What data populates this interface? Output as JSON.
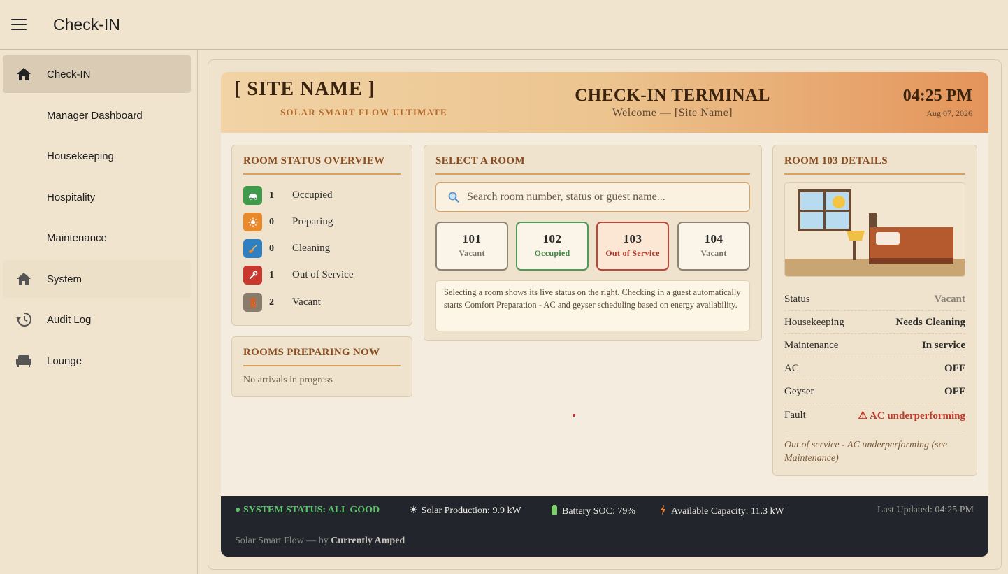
{
  "app": {
    "title": "Check-IN"
  },
  "sidebar": {
    "items": [
      {
        "label": "Check-IN",
        "icon": "home-icon"
      },
      {
        "label": "Manager Dashboard"
      },
      {
        "label": "Housekeeping"
      },
      {
        "label": "Hospitality"
      },
      {
        "label": "Maintenance"
      },
      {
        "label": "System",
        "icon": "home-icon"
      },
      {
        "label": "Audit Log",
        "icon": "history-icon"
      },
      {
        "label": "Lounge",
        "icon": "sofa-icon"
      }
    ]
  },
  "header": {
    "site_name": "[ SITE NAME ]",
    "subtitle": "SOLAR SMART FLOW ULTIMATE",
    "terminal_title": "CHECK-IN TERMINAL",
    "welcome": "Welcome — [Site Name]",
    "time": "04:25 PM",
    "date": "Aug 07, 2026"
  },
  "overview": {
    "title": "ROOM STATUS OVERVIEW",
    "rows": [
      {
        "count": "1",
        "label": "Occupied",
        "icon": "car-icon",
        "color": "#3f9a4c"
      },
      {
        "count": "0",
        "label": "Preparing",
        "icon": "sun-icon",
        "color": "#e8892c"
      },
      {
        "count": "0",
        "label": "Cleaning",
        "icon": "broom-icon",
        "color": "#2f7fc1"
      },
      {
        "count": "1",
        "label": "Out of Service",
        "icon": "wrench-icon",
        "color": "#c9382e"
      },
      {
        "count": "2",
        "label": "Vacant",
        "icon": "door-icon",
        "color": "#8a7c6c"
      }
    ]
  },
  "preparing": {
    "title": "ROOMS PREPARING NOW",
    "empty_text": "No arrivals in progress"
  },
  "select_room": {
    "title": "SELECT A ROOM",
    "search_placeholder": "Search room number, status or guest name...",
    "rooms": [
      {
        "number": "101",
        "status": "Vacant"
      },
      {
        "number": "102",
        "status": "Occupied"
      },
      {
        "number": "103",
        "status": "Out of Service"
      },
      {
        "number": "104",
        "status": "Vacant"
      }
    ],
    "note": "Selecting a room shows its live status on the right. Checking in a guest automatically starts Comfort Preparation - AC and geyser scheduling based on energy availability."
  },
  "details": {
    "title": "ROOM 103 DETAILS",
    "rows": [
      {
        "key": "Status",
        "value": "Vacant"
      },
      {
        "key": "Housekeeping",
        "value": "Needs Cleaning"
      },
      {
        "key": "Maintenance",
        "value": "In service"
      },
      {
        "key": "AC",
        "value": "OFF"
      },
      {
        "key": "Geyser",
        "value": "OFF"
      },
      {
        "key": "Fault",
        "value": "⚠ AC underperforming"
      }
    ],
    "note": "Out of service - AC underperforming (see Maintenance)"
  },
  "footer": {
    "status": "● SYSTEM STATUS: ALL GOOD",
    "solar": "Solar Production: 9.9 kW",
    "battery": "Battery SOC: 79%",
    "capacity": "Available Capacity: 11.3 kW",
    "updated": "Last Updated: 04:25 PM",
    "credit_prefix": "Solar Smart Flow — by",
    "credit_brand": "Currently Amped"
  }
}
